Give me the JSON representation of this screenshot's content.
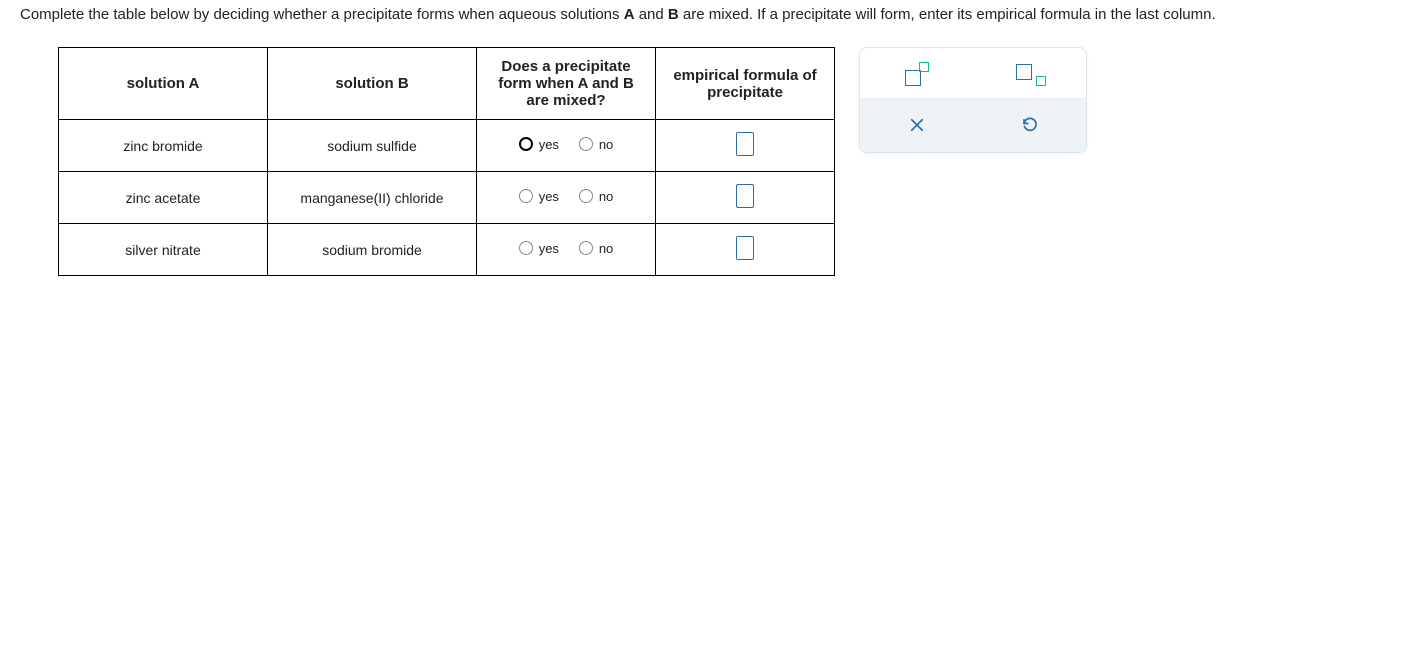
{
  "instructions": {
    "prefix": "Complete the table below by deciding whether a precipitate forms when aqueous solutions ",
    "boldA": "A",
    "mid1": " and ",
    "boldB": "B",
    "suffix": " are mixed. If a precipitate will form, enter its empirical formula in the last column."
  },
  "headers": {
    "colA": "solution A",
    "colB": "solution B",
    "colC": "Does a precipitate form when A and B are mixed?",
    "colD": "empirical formula of precipitate"
  },
  "radio": {
    "yes": "yes",
    "no": "no"
  },
  "rows": [
    {
      "a": "zinc bromide",
      "b": "sodium sulfide"
    },
    {
      "a": "zinc acetate",
      "b": "manganese(II) chloride"
    },
    {
      "a": "silver nitrate",
      "b": "sodium bromide"
    }
  ]
}
